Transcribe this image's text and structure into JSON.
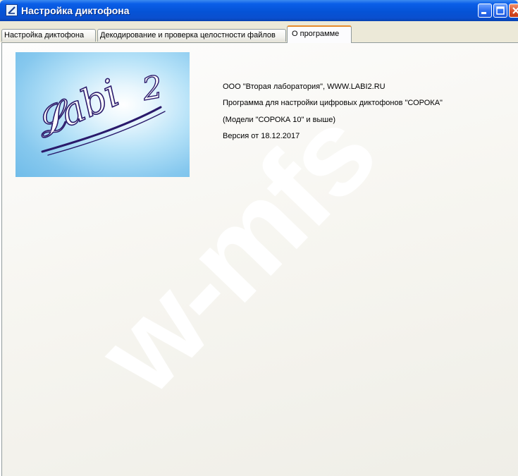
{
  "window": {
    "title": "Настройка диктофона",
    "icon": "app-logo-icon"
  },
  "titlebar_buttons": {
    "minimize": "minimize-icon",
    "maximize": "maximize-icon",
    "close": "close-icon"
  },
  "tabs": [
    {
      "label": "Настройка диктофона",
      "active": false
    },
    {
      "label": "Декодирование и проверка целостности файлов",
      "active": false
    },
    {
      "label": "О программе",
      "active": true
    }
  ],
  "about": {
    "logo_text": "Labi 2",
    "lines": [
      "ООО \"Вторая лаборатория\", WWW.LABI2.RU",
      "Программа для настройки цифровых диктофонов \"СОРОКА\"",
      "(Модели \"СОРОКА 10\" и выше)",
      "Версия от 18.12.2017"
    ]
  },
  "watermark": {
    "text": "w-mfs"
  },
  "colors": {
    "titlebar": "#0a5ee8",
    "active_tab_accent": "#e68b2c",
    "logo_script": "#2a1a6b",
    "logo_background": "#86c8ee"
  }
}
